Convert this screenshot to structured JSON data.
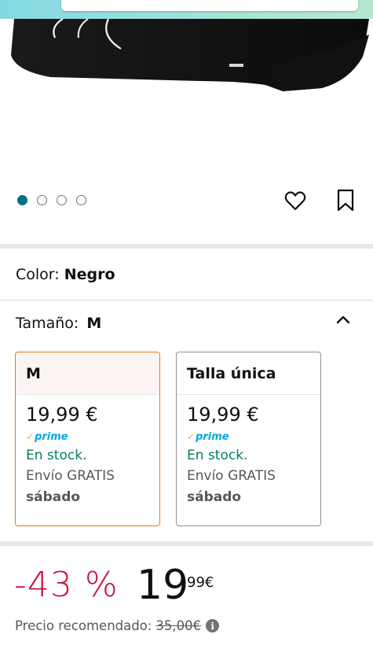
{
  "carousel": {
    "count": 4,
    "active_index": 0
  },
  "color": {
    "label": "Color: ",
    "value": "Negro"
  },
  "size": {
    "label": "Tamaño:",
    "value": "M",
    "options": [
      {
        "name": "M",
        "price": "19,99 €",
        "prime": "prime",
        "stock": "En stock.",
        "shipping": "Envío GRATIS",
        "day": "sábado",
        "selected": true
      },
      {
        "name": "Talla única",
        "price": "19,99 €",
        "prime": "prime",
        "stock": "En stock.",
        "shipping": "Envío GRATIS",
        "day": "sábado",
        "selected": false
      }
    ]
  },
  "pricing": {
    "discount": "-43 %",
    "price_whole": "19",
    "price_fraction": "99",
    "currency": "€",
    "list_price_label": "Precio recomendado:",
    "list_price_value": "35,00€"
  },
  "colors": {
    "accent_teal": "#007185",
    "discount_red": "#cc0c39",
    "in_stock_green": "#067d62",
    "selected_border": "#e47911",
    "prime_blue": "#00a8e1"
  },
  "icons": [
    "heart-icon",
    "bookmark-icon",
    "chevron-up-icon",
    "info-icon",
    "prime-check-icon"
  ]
}
